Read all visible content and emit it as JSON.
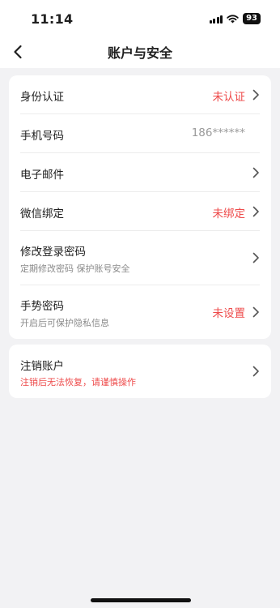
{
  "status": {
    "time": "11:14",
    "battery": "93"
  },
  "nav": {
    "title": "账户与安全"
  },
  "security": {
    "items": [
      {
        "label": "身份认证",
        "value": "未认证"
      },
      {
        "label": "手机号码",
        "value": "186******"
      },
      {
        "label": "电子邮件"
      },
      {
        "label": "微信绑定",
        "value": "未绑定"
      },
      {
        "label": "修改登录密码",
        "sub": "定期修改密码 保护账号安全"
      },
      {
        "label": "手势密码",
        "sub": "开启后可保护隐私信息",
        "value": "未设置"
      }
    ]
  },
  "account": {
    "label": "注销账户",
    "sub": "注销后无法恢复，请谨慎操作"
  },
  "colors": {
    "accent_red": "#ee4b4b",
    "background": "#f2f2f4",
    "card": "#ffffff"
  }
}
